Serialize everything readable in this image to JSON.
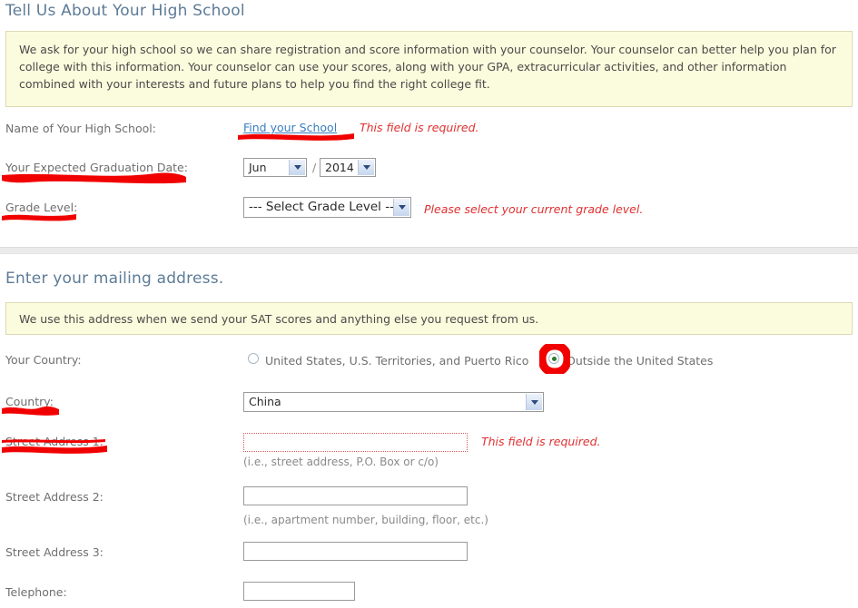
{
  "high_school_section": {
    "title": "Tell Us About Your High School",
    "note": "We ask for your high school so we can share registration and score information with your counselor. Your counselor can better help you plan for college with this information. Your counselor can use your scores, along with your GPA, extracurricular activities, and other information combined with your interests and future plans to help you find the right college fit.",
    "fields": {
      "school_name_label": "Name of Your High School:",
      "find_school_link": "Find your School",
      "school_name_error": "This field is required.",
      "grad_date_label": "Your Expected Graduation Date:",
      "grad_month_value": "Jun",
      "grad_date_separator": "/",
      "grad_year_value": "2014",
      "grade_level_label": "Grade Level:",
      "grade_level_value": "--- Select Grade Level --",
      "grade_level_error": "Please select your current grade level."
    }
  },
  "address_section": {
    "title": "Enter your mailing address.",
    "note": "We use this address when we send your SAT scores and anything else you request from us.",
    "fields": {
      "your_country_label": "Your Country:",
      "radio_us_label": "United States, U.S. Territories, and Puerto Rico",
      "radio_outside_label": "Outside the United States",
      "country_label": "Country:",
      "country_value": "China",
      "street1_label": "Street Address 1:",
      "street1_value": "",
      "street1_error": "This field is required.",
      "street1_hint": "(i.e., street address, P.O. Box or c/o)",
      "street2_label": "Street Address 2:",
      "street2_value": "",
      "street2_hint": "(i.e., apartment number, building, floor, etc.)",
      "street3_label": "Street Address 3:",
      "street3_value": "",
      "telephone_label": "Telephone:",
      "telephone_value": ""
    }
  },
  "colors": {
    "heading": "#5d7b96",
    "note_background": "#fbfbdd",
    "note_border": "#ded9b4",
    "error_text": "#e03030",
    "link": "#3a7ebf",
    "annotation_red": "#f10000",
    "radio_selected": "#2f7a2f"
  }
}
